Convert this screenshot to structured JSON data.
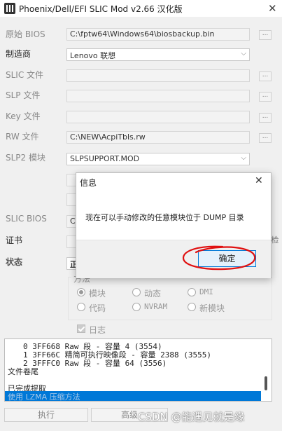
{
  "window": {
    "title": "Phoenix/Dell/EFI SLIC Mod v2.66 汉化版",
    "close_glyph": "✕",
    "app_icon": "film-icon"
  },
  "rows": [
    {
      "label": "原始 BIOS",
      "value": "C:\\fptw64\\Windows64\\biosbackup.bin",
      "browse": "..."
    },
    {
      "label": "制造商",
      "value": "Lenovo 联想"
    },
    {
      "label": "SLIC 文件",
      "value": "",
      "browse": "..."
    },
    {
      "label": "SLP 文件",
      "value": "",
      "browse": "..."
    },
    {
      "label": "Key 文件",
      "value": "",
      "browse": "..."
    },
    {
      "label": "RW 文件",
      "value": "C:\\NEW\\AcpiTbls.rw",
      "browse": "..."
    },
    {
      "label": "SLP2 模块",
      "value": "SLPSUPPORT.MOD"
    }
  ],
  "slic_bios": {
    "label": "SLIC BIOS",
    "value": "C:"
  },
  "cert": {
    "label": "证书",
    "right_fragment": "检"
  },
  "status": {
    "label": "状态",
    "tab_fragment": "正"
  },
  "method": {
    "title": "方法",
    "options": [
      "模块",
      "动态",
      "DMI",
      "代码",
      "NVRAM",
      "新模块"
    ],
    "selected": "模块"
  },
  "log_checkbox": "日志",
  "log_lines": [
    "0 3FF668 Raw 段 - 容量 4  (3554)",
    "1 3FF66C 精简可执行映像段 - 容量 2388  (3555)",
    "2 3FFFC0 Raw 段 - 容量 64  (3556)",
    "文件卷尾",
    "",
    "已完成提取",
    "使用 LZMA 压缩方法"
  ],
  "buttons": {
    "execute": "执行",
    "advanced": "高级"
  },
  "watermark": "CSDN @能遇见就是缘",
  "dialog": {
    "title": "信息",
    "message": "现在可以手动修改的任意模块位于 DUMP 目录",
    "ok": "确定",
    "close_glyph": "✕"
  },
  "colors": {
    "accent": "#0078d7",
    "annotation": "#e01010"
  }
}
